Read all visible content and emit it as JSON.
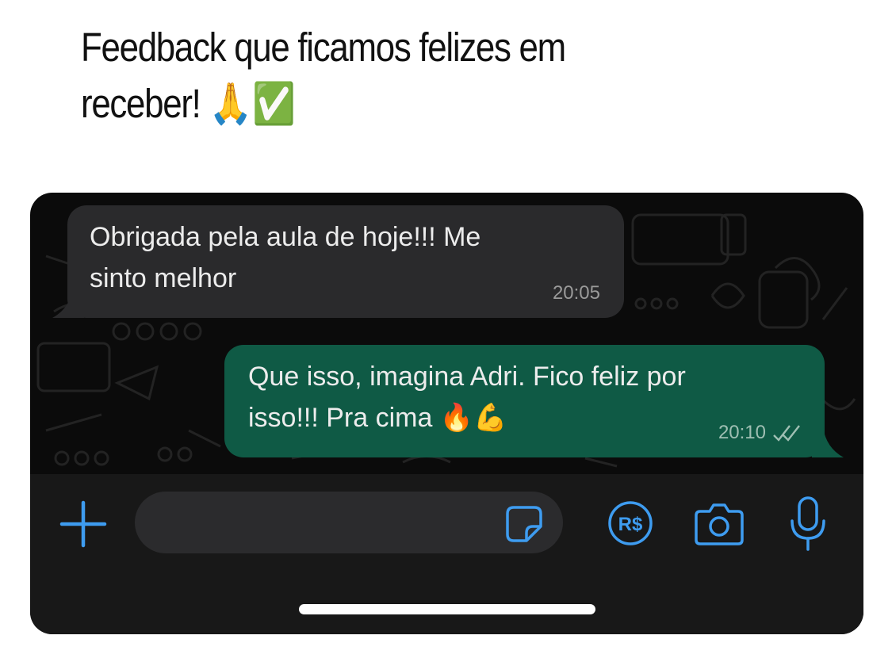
{
  "caption": {
    "line1": "Feedback que ficamos felizes em",
    "line2": "receber!",
    "emoji": "🙏✅"
  },
  "messages": [
    {
      "direction": "incoming",
      "text": "Obrigada pela aula de hoje!!! Me\nsinto melhor",
      "time": "20:05"
    },
    {
      "direction": "outgoing",
      "text": "Que isso, imagina Adri. Fico feliz por\nisso!!! Pra cima 🔥💪",
      "time": "20:10",
      "status_icon": "double-check-icon"
    }
  ],
  "input_bar": {
    "message_value": "",
    "icons": [
      "plus-icon",
      "sticker-icon",
      "pix-payment-icon",
      "camera-icon",
      "microphone-icon"
    ],
    "pay_label": "R$"
  },
  "colors": {
    "accent": "#3e9cf0",
    "incoming_bubble": "#2a2a2c",
    "outgoing_bubble": "#0f5a45",
    "background": "#0b0b0b"
  }
}
